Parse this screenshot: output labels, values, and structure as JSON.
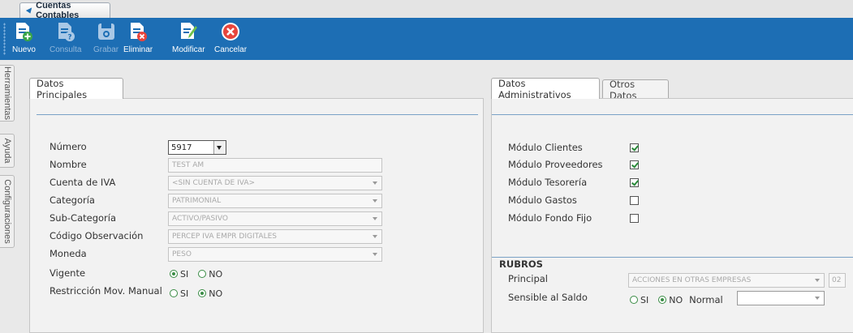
{
  "window": {
    "tab_title": "Cuentas Contables"
  },
  "toolbar": {
    "nuevo": "Nuevo",
    "consulta": "Consulta",
    "grabar": "Grabar",
    "eliminar": "Eliminar",
    "modificar": "Modificar",
    "cancelar": "Cancelar"
  },
  "side_tabs": {
    "herramientas": "Herramientas",
    "ayuda": "Ayuda",
    "configuraciones": "Configuraciones"
  },
  "datos_principales": {
    "tab": "Datos Principales",
    "numero_label": "Número",
    "numero_value": "5917",
    "nombre_label": "Nombre",
    "nombre_value": "TEST AM",
    "cuenta_iva_label": "Cuenta de IVA",
    "cuenta_iva_value": "<SIN CUENTA DE IVA>",
    "categoria_label": "Categoría",
    "categoria_value": "PATRIMONIAL",
    "subcategoria_label": "Sub-Categoría",
    "subcategoria_value": "ACTIVO/PASIVO",
    "codigo_obs_label": "Código Observación",
    "codigo_obs_value": "PERCEP IVA EMPR DIGITALES",
    "moneda_label": "Moneda",
    "moneda_value": "PESO",
    "vigente_label": "Vigente",
    "restriccion_label": "Restricción Mov. Manual",
    "si": "SI",
    "no": "NO"
  },
  "datos_administrativos": {
    "tab": "Datos Administrativos",
    "tab_otros": "Otros Datos",
    "modulo_clientes": "Módulo Clientes",
    "modulo_proveedores": "Módulo Proveedores",
    "modulo_tesoreria": "Módulo Tesorería",
    "modulo_gastos": "Módulo Gastos",
    "modulo_fondo_fijo": "Módulo Fondo Fijo",
    "rubros_title": "RUBROS",
    "principal_label": "Principal",
    "principal_value": "ACCIONES EN OTRAS EMPRESAS",
    "principal_code": "02",
    "sensible_label": "Sensible al Saldo",
    "si": "SI",
    "no": "NO",
    "normal_label": "Normal",
    "normal_value": ""
  },
  "colors": {
    "toolbar_bg": "#1d6eb4",
    "accent_green": "#3a8c45",
    "panel_line": "#7aa1c6"
  }
}
